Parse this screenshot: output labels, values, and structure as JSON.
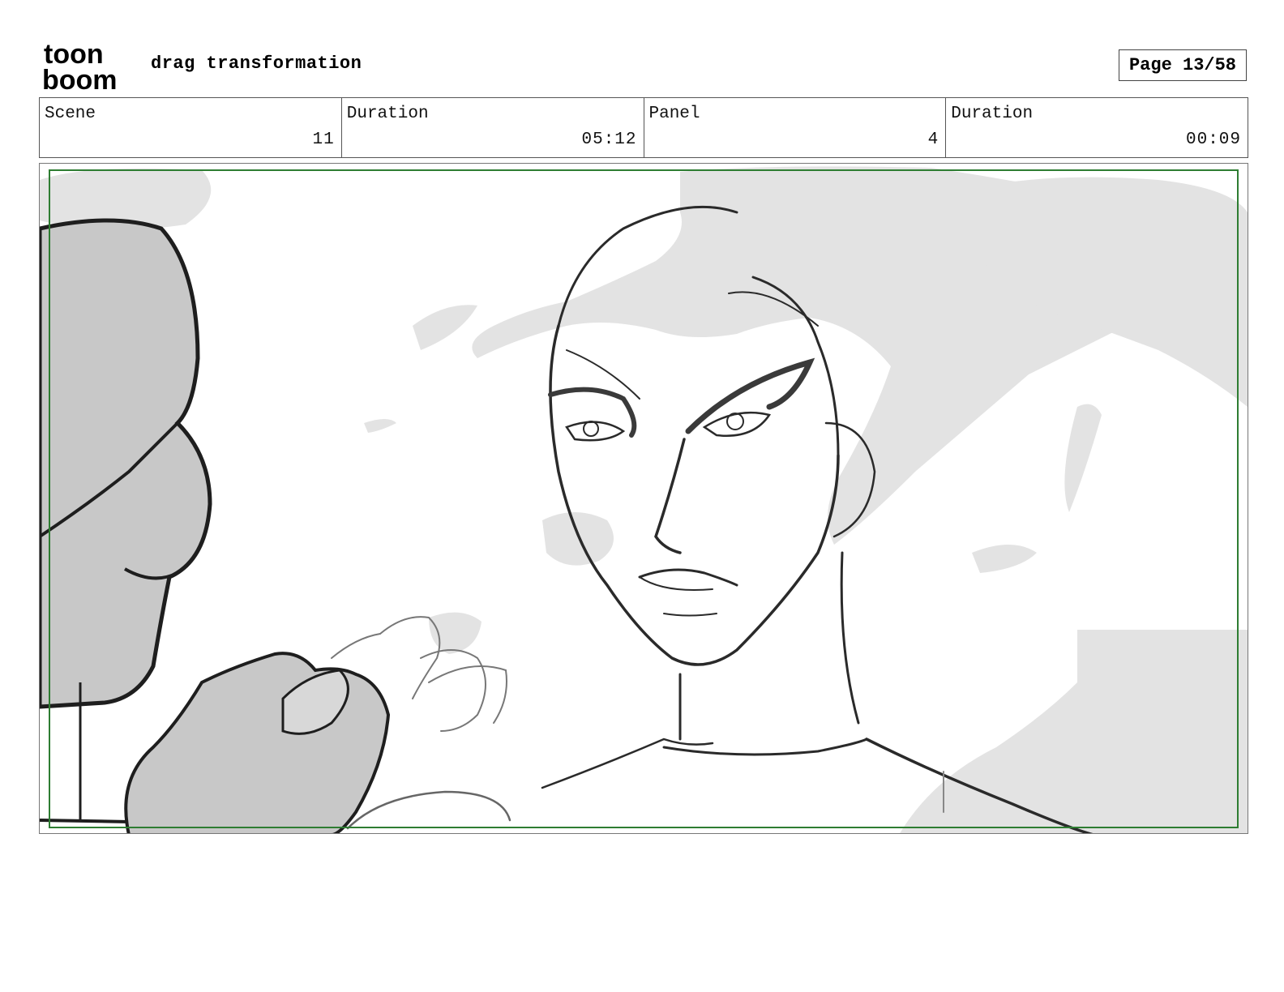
{
  "header": {
    "logo_text_top": "toon",
    "logo_text_bottom": "boom",
    "document_title": "drag transformation",
    "page_label": "Page 13/58"
  },
  "info": {
    "scene_label": "Scene",
    "scene_value": "11",
    "scene_duration_label": "Duration",
    "scene_duration_value": "05:12",
    "panel_label": "Panel",
    "panel_value": "4",
    "panel_duration_label": "Duration",
    "panel_duration_value": "00:09"
  },
  "colors": {
    "safe_frame": "#2e7d32",
    "smoke": "#e3e3e3",
    "shadow_fill": "#c8c8c8",
    "ink": "#2a2a2a"
  }
}
